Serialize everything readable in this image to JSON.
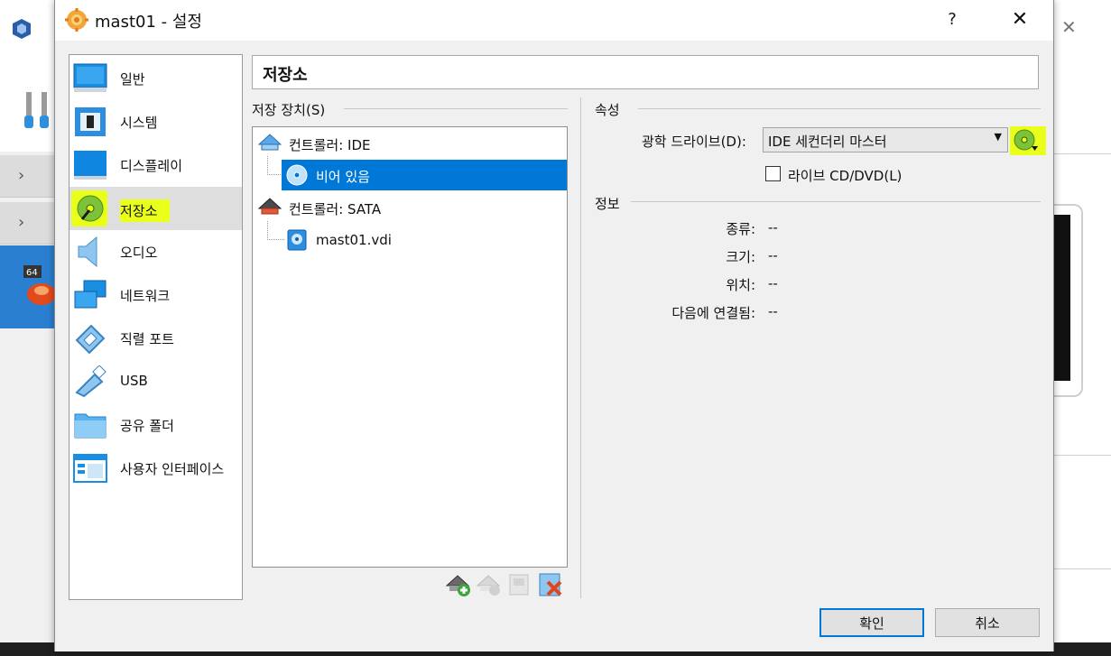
{
  "dialog": {
    "title": "mast01 - 설정",
    "help": "?",
    "close": "✕"
  },
  "nav": {
    "items": [
      {
        "label": "일반",
        "icon": "monitor-icon"
      },
      {
        "label": "시스템",
        "icon": "chip-icon"
      },
      {
        "label": "디스플레이",
        "icon": "display-icon"
      },
      {
        "label": "저장소",
        "icon": "storage-icon",
        "selected": true,
        "highlighted": true
      },
      {
        "label": "오디오",
        "icon": "speaker-icon"
      },
      {
        "label": "네트워크",
        "icon": "network-icon"
      },
      {
        "label": "직렬 포트",
        "icon": "serial-port-icon"
      },
      {
        "label": "USB",
        "icon": "usb-icon"
      },
      {
        "label": "공유 폴더",
        "icon": "folder-icon"
      },
      {
        "label": "사용자 인터페이스",
        "icon": "window-icon"
      }
    ]
  },
  "page": {
    "title": "저장소",
    "devices_label": "저장 장치(S)",
    "attributes_label": "속성",
    "info_label": "정보"
  },
  "tree": {
    "ide_controller": "컨트롤러: IDE",
    "ide_empty": "비어 있음",
    "sata_controller": "컨트롤러: SATA",
    "sata_disk": "mast01.vdi"
  },
  "attributes": {
    "optical_drive_label": "광학 드라이브(D):",
    "optical_drive_value": "IDE 세컨더리 마스터",
    "live_cd_label": "라이브 CD/DVD(L)",
    "live_cd_checked": false
  },
  "info": {
    "type_label": "종류:",
    "type_value": "--",
    "size_label": "크기:",
    "size_value": "--",
    "location_label": "위치:",
    "location_value": "--",
    "attached_label": "다음에 연결됨:",
    "attached_value": "--"
  },
  "buttons": {
    "ok": "확인",
    "cancel": "취소"
  },
  "colors": {
    "highlight": "#e9ff1a",
    "selection": "#0078d7"
  }
}
